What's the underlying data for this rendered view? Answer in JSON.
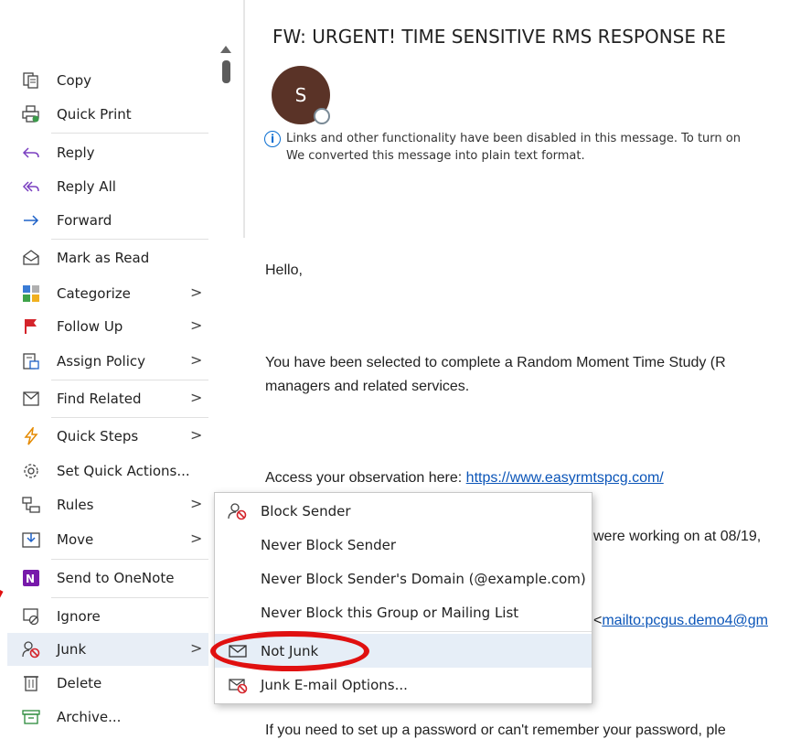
{
  "email": {
    "subject": "FW: URGENT! TIME SENSITIVE RMS RESPONSE RE",
    "avatar_initial": "S",
    "info_line1": "Links and other functionality have been disabled in this message. To turn on",
    "info_line2": "We converted this message into plain text format.",
    "greeting": "Hello,",
    "para1_line1": "You have been selected to complete a Random Moment Time Study (R",
    "para1_line2": "managers and related services.",
    "access_text": "Access your observation here: ",
    "access_link": "https://www.easyrmtspcg.com/",
    "partial_line": "were working on at 08/19,",
    "mailto_prefix": "<",
    "mailto_link": "mailto:pcgus.demo4@gm",
    "bottom_line": "If you need to set up a password or can't remember your password, ple"
  },
  "context_menu": {
    "items": [
      {
        "label": "Copy",
        "icon": "copy-icon"
      },
      {
        "label": "Quick Print",
        "icon": "quick-print-icon"
      },
      {
        "label": "Reply",
        "icon": "reply-icon"
      },
      {
        "label": "Reply All",
        "icon": "reply-all-icon"
      },
      {
        "label": "Forward",
        "icon": "forward-icon"
      },
      {
        "label": "Mark as Read",
        "icon": "mark-read-icon"
      },
      {
        "label": "Categorize",
        "icon": "categorize-icon"
      },
      {
        "label": "Follow Up",
        "icon": "flag-icon"
      },
      {
        "label": "Assign Policy",
        "icon": "assign-policy-icon"
      },
      {
        "label": "Find Related",
        "icon": "find-related-icon"
      },
      {
        "label": "Quick Steps",
        "icon": "lightning-icon"
      },
      {
        "label": "Set Quick Actions...",
        "icon": "gear-icon"
      },
      {
        "label": "Rules",
        "icon": "rules-icon"
      },
      {
        "label": "Move",
        "icon": "move-icon"
      },
      {
        "label": "Send to OneNote",
        "icon": "onenote-icon"
      },
      {
        "label": "Ignore",
        "icon": "ignore-icon"
      },
      {
        "label": "Junk",
        "icon": "junk-icon"
      },
      {
        "label": "Delete",
        "icon": "trash-icon"
      },
      {
        "label": "Archive...",
        "icon": "archive-icon"
      }
    ],
    "submenu_arrow": ">"
  },
  "junk_submenu": {
    "items": [
      {
        "label": "Block Sender",
        "icon": "block-sender-icon"
      },
      {
        "label": "Never Block Sender"
      },
      {
        "label": "Never Block Sender's Domain (@example.com)"
      },
      {
        "label": "Never Block this Group or Mailing List"
      },
      {
        "label": "Not Junk",
        "icon": "envelope-icon"
      },
      {
        "label": "Junk E-mail Options...",
        "icon": "junk-options-icon"
      }
    ]
  },
  "colors": {
    "avatar": "#5a3327",
    "link": "#0b55b8",
    "highlight": "#e6eef7",
    "annotation_red": "#e01010"
  }
}
